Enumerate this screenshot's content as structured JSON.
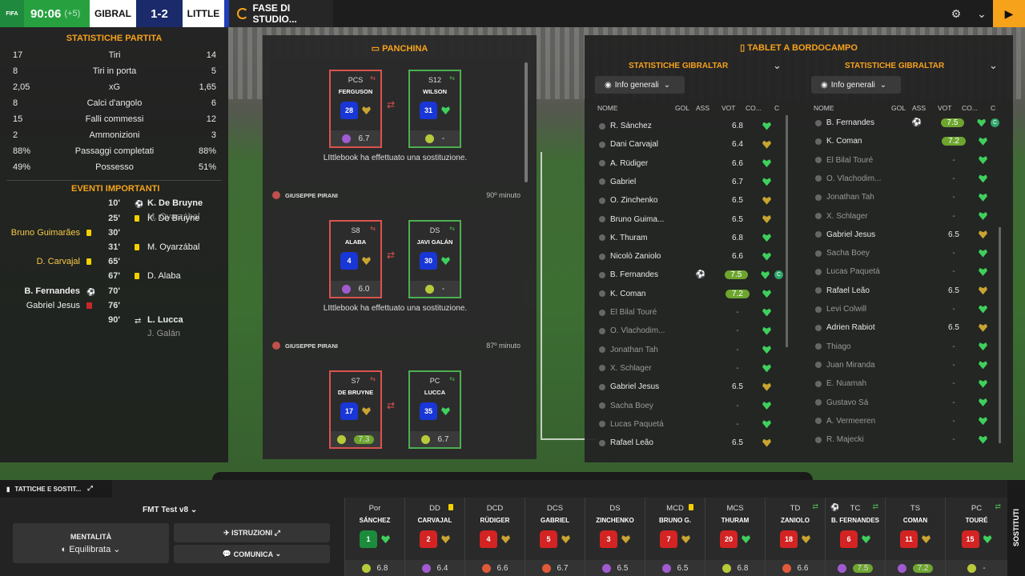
{
  "topbar": {
    "fifa": "FIFA",
    "clock": "90:06",
    "extra": "(+5)",
    "home": "GIBRAL",
    "score": "1-2",
    "away": "LITTLE",
    "phase": "FASE DI STUDIO..."
  },
  "match_stats": {
    "title": "STATISTICHE PARTITA",
    "rows": [
      {
        "l": "17",
        "label": "Tiri",
        "r": "14"
      },
      {
        "l": "8",
        "label": "Tiri in porta",
        "r": "5"
      },
      {
        "l": "2,05",
        "label": "xG",
        "r": "1,65"
      },
      {
        "l": "8",
        "label": "Calci d'angolo",
        "r": "6"
      },
      {
        "l": "15",
        "label": "Falli commessi",
        "r": "12"
      },
      {
        "l": "2",
        "label": "Ammonizioni",
        "r": "3"
      },
      {
        "l": "88%",
        "label": "Passaggi completati",
        "r": "88%"
      },
      {
        "l": "49%",
        "label": "Possesso",
        "r": "51%"
      }
    ]
  },
  "events": {
    "title": "EVENTI IMPORTANTI",
    "items": [
      {
        "min": "10'",
        "right": "K. De Bruyne",
        "right2": "M. Oyarzábal",
        "left": ""
      },
      {
        "min": "25'",
        "right": "K. De Bruyne",
        "left": ""
      },
      {
        "min": "30'",
        "right": "",
        "left": "Bruno Guimarães"
      },
      {
        "min": "31'",
        "right": "M. Oyarzábal",
        "left": ""
      },
      {
        "min": "65'",
        "right": "",
        "left": "D. Carvajal"
      },
      {
        "min": "67'",
        "right": "D. Alaba",
        "left": ""
      },
      {
        "min": "70'",
        "right": "",
        "left": "B. Fernandes"
      },
      {
        "min": "76'",
        "right": "",
        "left": "Gabriel Jesus"
      },
      {
        "min": "90'",
        "right": "L. Lucca",
        "right2": "J. Galán",
        "left": ""
      }
    ]
  },
  "bench": {
    "title": "PANCHINA",
    "subs": [
      {
        "out_pos": "PCS",
        "out_name": "FERGUSON",
        "out_num": "28",
        "out_rating": "6.7",
        "in_pos": "S12",
        "in_name": "WILSON",
        "in_num": "31",
        "in_rating": "-",
        "text": "LIttlebook ha effettuato una sostituzione.",
        "coach": "GIUSEPPE PIRANI",
        "minute": "90º minuto"
      },
      {
        "out_pos": "S8",
        "out_name": "ALABA",
        "out_num": "4",
        "out_rating": "6.0",
        "in_pos": "DS",
        "in_name": "JAVI GALÁN",
        "in_num": "30",
        "in_rating": "-",
        "text": "LIttlebook ha effettuato una sostituzione.",
        "coach": "GIUSEPPE PIRANI",
        "minute": "87º minuto"
      },
      {
        "out_pos": "S7",
        "out_name": "DE BRUYNE",
        "out_num": "17",
        "out_rating": "7.3",
        "in_pos": "PC",
        "in_name": "LUCCA",
        "in_num": "35",
        "in_rating": "6.7"
      }
    ]
  },
  "tablet": {
    "title": "TABLET A BORDOCAMPO",
    "left": {
      "header": "STATISTICHE GIBRALTAR",
      "dropdown": "Info generali",
      "cols": [
        "NOME",
        "GOL",
        "ASS",
        "VOT",
        "CO...",
        "C"
      ],
      "rows": [
        {
          "n": "R. Sánchez",
          "v": "6.8"
        },
        {
          "n": "Dani Carvajal",
          "v": "6.4"
        },
        {
          "n": "A. Rüdiger",
          "v": "6.6"
        },
        {
          "n": "Gabriel",
          "v": "6.7"
        },
        {
          "n": "O. Zinchenko",
          "v": "6.5"
        },
        {
          "n": "Bruno Guima...",
          "v": "6.5"
        },
        {
          "n": "K. Thuram",
          "v": "6.8"
        },
        {
          "n": "Nicolò Zaniolo",
          "v": "6.6"
        },
        {
          "n": "B. Fernandes",
          "v": "7.5"
        },
        {
          "n": "K. Coman",
          "v": "7.2"
        },
        {
          "n": "El Bilal Touré",
          "v": "-"
        },
        {
          "n": "O. Vlachodim...",
          "v": "-"
        },
        {
          "n": "Jonathan Tah",
          "v": "-"
        },
        {
          "n": "X. Schlager",
          "v": "-"
        },
        {
          "n": "Gabriel Jesus",
          "v": "6.5"
        },
        {
          "n": "Sacha Boey",
          "v": "-"
        },
        {
          "n": "Lucas Paquetá",
          "v": "-"
        },
        {
          "n": "Rafael Leão",
          "v": "6.5"
        }
      ]
    },
    "right": {
      "header": "STATISTICHE GIBRALTAR",
      "dropdown": "Info generali",
      "cols": [
        "NOME",
        "GOL",
        "ASS",
        "VOT",
        "CO...",
        "C"
      ],
      "rows": [
        {
          "n": "B. Fernandes",
          "v": "7.5"
        },
        {
          "n": "K. Coman",
          "v": "7.2"
        },
        {
          "n": "El Bilal Touré",
          "v": "-"
        },
        {
          "n": "O. Vlachodim...",
          "v": "-"
        },
        {
          "n": "Jonathan Tah",
          "v": "-"
        },
        {
          "n": "X. Schlager",
          "v": "-"
        },
        {
          "n": "Gabriel Jesus",
          "v": "6.5"
        },
        {
          "n": "Sacha Boey",
          "v": "-"
        },
        {
          "n": "Lucas Paquetá",
          "v": "-"
        },
        {
          "n": "Rafael Leão",
          "v": "6.5"
        },
        {
          "n": "Levi Colwill",
          "v": "-"
        },
        {
          "n": "Adrien Rabiot",
          "v": "6.5"
        },
        {
          "n": "Thiago",
          "v": "-"
        },
        {
          "n": "Juan Miranda",
          "v": "-"
        },
        {
          "n": "E. Nuamah",
          "v": "-"
        },
        {
          "n": "Gustavo Sá",
          "v": "-"
        },
        {
          "n": "A. Vermeeren",
          "v": "-"
        },
        {
          "n": "R. Majecki",
          "v": "-"
        }
      ]
    }
  },
  "bottom": {
    "tactics": "TATTICHE E SOSTIT...",
    "team": "FMT Test v8",
    "mentality_label": "MENTALITÀ",
    "mentality": "Equilibrata",
    "instructions": "ISTRUZIONI",
    "communicate": "COMUNICA",
    "subs_side": "SOSTITUTI",
    "lineup": [
      {
        "pos": "Por",
        "nm": "SÁNCHEZ",
        "num": "1",
        "r": "6.8"
      },
      {
        "pos": "DD",
        "nm": "CARVAJAL",
        "num": "2",
        "r": "6.4"
      },
      {
        "pos": "DCD",
        "nm": "RÜDIGER",
        "num": "4",
        "r": "6.6"
      },
      {
        "pos": "DCS",
        "nm": "GABRIEL",
        "num": "5",
        "r": "6.7"
      },
      {
        "pos": "DS",
        "nm": "ZINCHENKO",
        "num": "3",
        "r": "6.5"
      },
      {
        "pos": "MCD",
        "nm": "BRUNO G.",
        "num": "7",
        "r": "6.5"
      },
      {
        "pos": "MCS",
        "nm": "THURAM",
        "num": "20",
        "r": "6.8"
      },
      {
        "pos": "TD",
        "nm": "ZANIOLO",
        "num": "18",
        "r": "6.6"
      },
      {
        "pos": "TC",
        "nm": "B. FERNANDES",
        "num": "6",
        "r": "7.5"
      },
      {
        "pos": "TS",
        "nm": "COMAN",
        "num": "11",
        "r": "7.2"
      },
      {
        "pos": "PC",
        "nm": "TOURÉ",
        "num": "15",
        "r": "-"
      }
    ]
  }
}
